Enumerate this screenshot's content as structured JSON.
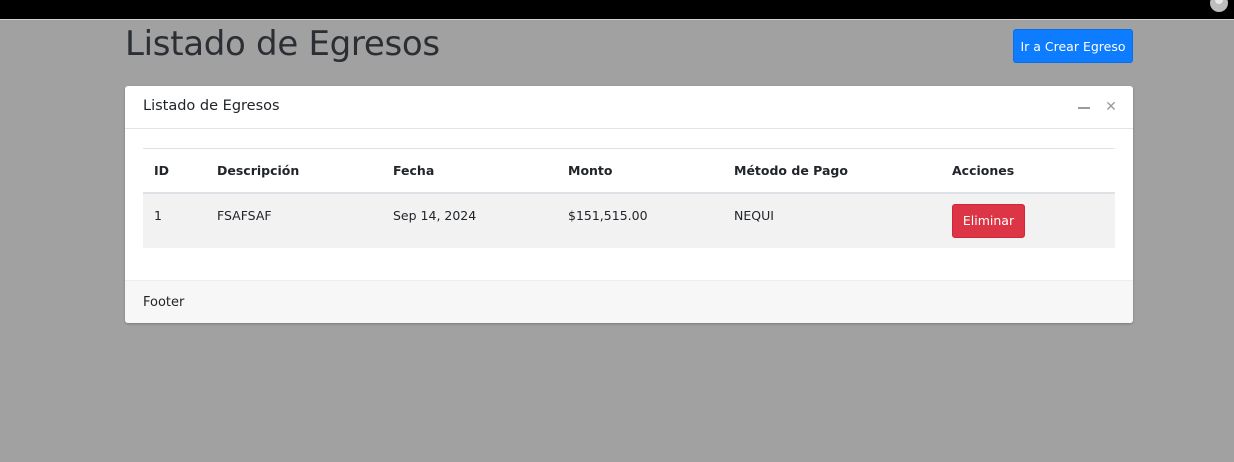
{
  "header": {
    "title": "Listado de Egresos",
    "create_button": "Ir a Crear Egreso"
  },
  "card": {
    "title": "Listado de Egresos",
    "columns": [
      "ID",
      "Descripción",
      "Fecha",
      "Monto",
      "Método de Pago",
      "Acciones"
    ],
    "rows": [
      {
        "id": "1",
        "descripcion": "FSAFSAF",
        "fecha": "Sep 14, 2024",
        "monto": "$151,515.00",
        "metodo": "NEQUI",
        "delete_label": "Eliminar"
      }
    ],
    "footer": "Footer"
  },
  "colors": {
    "primary": "#0d7cff",
    "danger": "#dc3545",
    "backdrop": "#a1a1a1"
  },
  "icons": [
    "user-icon",
    "minimize-icon",
    "close-icon"
  ]
}
